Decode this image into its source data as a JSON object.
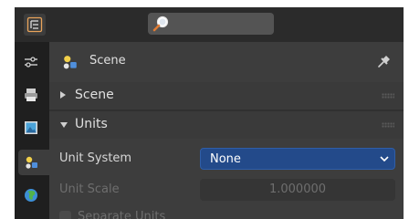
{
  "header": {
    "editor_type_icon": "properties-editor-icon",
    "search_icon": "search-icon"
  },
  "tabs": [
    {
      "icon": "tool-settings-icon",
      "active": false
    },
    {
      "icon": "output-printer-icon",
      "active": false
    },
    {
      "icon": "view-layer-image-icon",
      "active": false
    },
    {
      "icon": "scene-icon",
      "active": true
    },
    {
      "icon": "world-globe-icon",
      "active": false
    }
  ],
  "context": {
    "label": "Scene",
    "icon": "scene-icon",
    "pin_icon": "pin-icon"
  },
  "panels": {
    "scene": {
      "title": "Scene",
      "expanded": false
    },
    "units": {
      "title": "Units",
      "expanded": true
    }
  },
  "units": {
    "unit_system_label": "Unit System",
    "unit_system_value": "None",
    "unit_scale_label": "Unit Scale",
    "unit_scale_value": "1.000000",
    "separate_units_label": "Separate Units",
    "separate_units_checked": false
  },
  "colors": {
    "accent_select": "#234a8a",
    "panel_bg": "#3d3d3d",
    "editor_bg": "#303030",
    "tab_bar_bg": "#1f1f1f"
  }
}
